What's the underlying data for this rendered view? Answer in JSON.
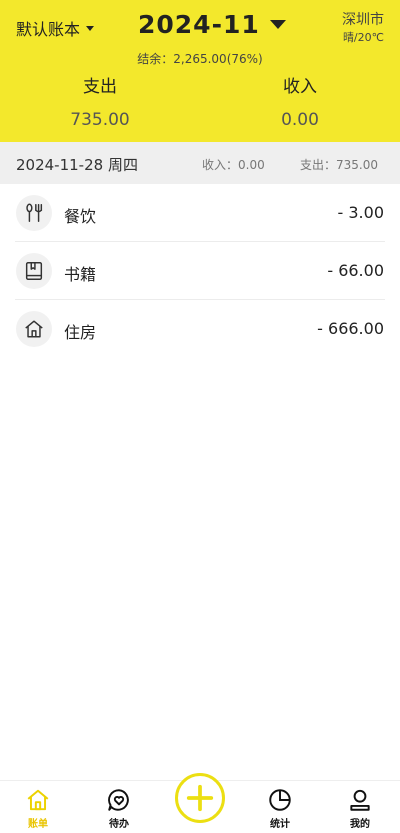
{
  "header": {
    "book": "默认账本",
    "month": "2024-11",
    "balance": "结余：2,265.00(76%)",
    "city": "深圳市",
    "weather": "晴/20℃",
    "expense_label": "支出",
    "expense_value": "735.00",
    "income_label": "收入",
    "income_value": "0.00",
    "accent": "#f3e82c"
  },
  "day": {
    "date": "2024-11-28  周四",
    "income": "收入：0.00",
    "expense": "支出：735.00"
  },
  "records": [
    {
      "category": "餐饮",
      "amount": "- 3.00",
      "icon": "fork-knife-icon"
    },
    {
      "category": "书籍",
      "amount": "- 66.00",
      "icon": "book-icon"
    },
    {
      "category": "住房",
      "amount": "- 666.00",
      "icon": "house-icon"
    }
  ],
  "tabs": [
    {
      "label": "账单",
      "icon": "home-icon",
      "active": true
    },
    {
      "label": "待办",
      "icon": "heart-chat-icon"
    },
    {
      "label": "",
      "icon": "plus-icon"
    },
    {
      "label": "统计",
      "icon": "pie-chart-icon"
    },
    {
      "label": "我的",
      "icon": "user-icon"
    }
  ]
}
